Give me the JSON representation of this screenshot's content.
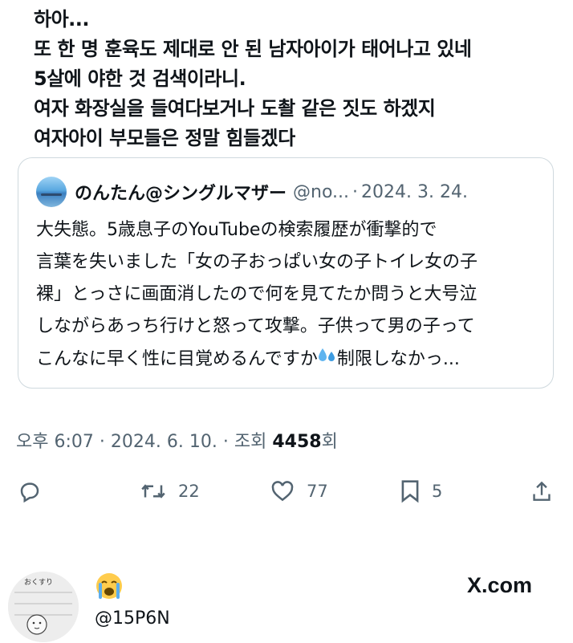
{
  "tweet": {
    "lines": [
      "하아...",
      "또 한 명 훈육도 제대로 안 된 남자아이가 태어나고 있네",
      "5살에 야한 것 검색이라니.",
      "여자 화장실을 들여다보거나 도촬 같은 짓도 하겠지",
      "여자아이 부모들은 정말 힘들겠다"
    ]
  },
  "quote": {
    "name": "のんたん@シングルマザー",
    "handle": "@no...",
    "separator": "·",
    "date": "2024. 3. 24.",
    "body_lines": [
      "大失態。5歳息子のYouTubeの検索履歴が衝撃的で",
      "言葉を失いました「女の子おっぱい女の子トイレ女の子",
      "裸」とっさに画面消したので何を見てたか問うと大号泣",
      "しながらあっち行けと怒って攻撃。子供って男の子って"
    ],
    "last_line_before_icon": "こんなに早く性に目覚めるんですか",
    "last_line_icon": "sweat-droplets-icon",
    "last_line_after_icon": "制限しなかっ..."
  },
  "meta": {
    "time": "오후 6:07",
    "sep1": "·",
    "date": "2024. 6. 10.",
    "sep2": "·",
    "views_label": "조회",
    "views_count": "4458",
    "views_suffix": "회"
  },
  "actions": {
    "reply_count": "",
    "retweet_count": "22",
    "like_count": "77",
    "bookmark_count": "5"
  },
  "reply": {
    "emoji": "loudly-crying-face",
    "handle": "@15P6N",
    "site": "X.com",
    "avatar_text": "おくすり"
  },
  "colors": {
    "text": "#0f1419",
    "secondary": "#536471",
    "border": "#cfd9de"
  }
}
